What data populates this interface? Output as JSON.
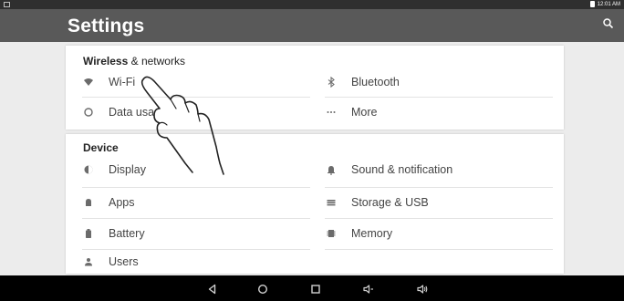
{
  "status_bar": {
    "time": "12:01 AM"
  },
  "app_bar": {
    "title": "Settings"
  },
  "sections": {
    "wireless": {
      "header_main": "Wireless",
      "header_amp": " & networks",
      "items": {
        "wifi": "Wi-Fi",
        "bluetooth": "Bluetooth",
        "data_usage": "Data usa",
        "more": "More"
      }
    },
    "device": {
      "header": "Device",
      "items": {
        "display": "Display",
        "sound": "Sound & notification",
        "apps": "Apps",
        "storage": "Storage & USB",
        "battery": "Battery",
        "memory": "Memory",
        "users": "Users"
      }
    }
  }
}
